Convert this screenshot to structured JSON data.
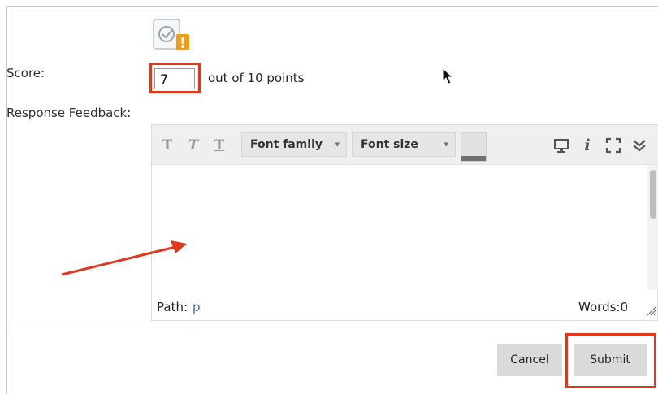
{
  "form": {
    "score_label": "Score:",
    "score_value": "7",
    "score_suffix": "out of 10 points",
    "feedback_label": "Response Feedback:"
  },
  "editor": {
    "toolbar": {
      "text_style_buttons": [
        "T",
        "T",
        "T"
      ],
      "font_family": "Font family",
      "font_size": "Font size",
      "color_swatch": "#6f6f6f",
      "icons": [
        "preview-icon",
        "info-icon",
        "fullscreen-icon",
        "expand-toolbar-icon"
      ]
    },
    "status": {
      "path_label": "Path:",
      "path_value": "p",
      "words": "Words:0"
    }
  },
  "actions": {
    "cancel": "Cancel",
    "submit": "Submit"
  },
  "colors": {
    "annotation_red": "#e2361d",
    "button_bg": "#dadada"
  }
}
